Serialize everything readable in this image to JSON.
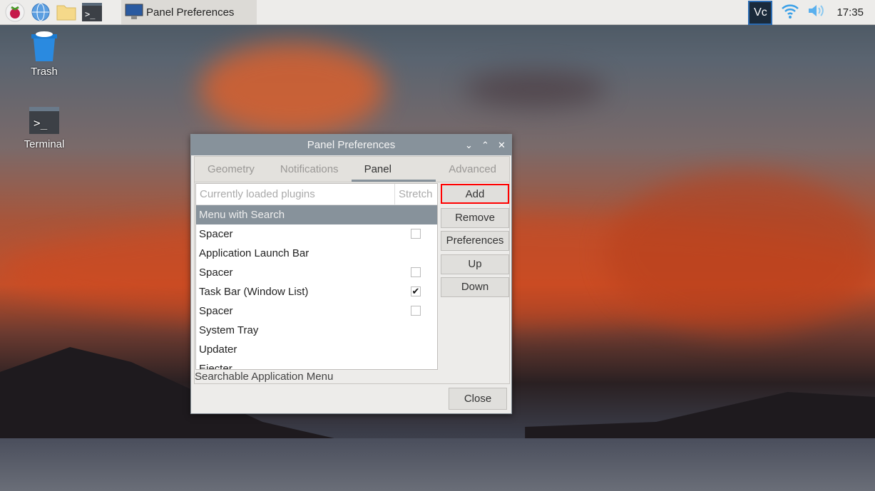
{
  "taskbar": {
    "task_label": "Panel Preferences",
    "clock": "17:35",
    "icons": [
      "raspberry-menu-icon",
      "browser-globe-icon",
      "file-manager-folder-icon",
      "terminal-icon"
    ],
    "tray_icons": [
      "vnc-icon",
      "wifi-icon",
      "volume-icon"
    ]
  },
  "desktop": {
    "icons": [
      {
        "label": "Trash",
        "icon": "trash-icon"
      },
      {
        "label": "Terminal",
        "icon": "terminal-icon"
      }
    ]
  },
  "dialog": {
    "title": "Panel Preferences",
    "tabs": [
      "Geometry",
      "Notifications",
      "Panel Applets",
      "Advanced"
    ],
    "active_tab": "Panel Applets",
    "list": {
      "col_plugins": "Currently loaded plugins",
      "col_stretch": "Stretch",
      "rows": [
        {
          "name": "Menu with Search",
          "stretch": null,
          "selected": true
        },
        {
          "name": "Spacer",
          "stretch": false
        },
        {
          "name": "Application Launch Bar",
          "stretch": null
        },
        {
          "name": "Spacer",
          "stretch": false
        },
        {
          "name": "Task Bar (Window List)",
          "stretch": true
        },
        {
          "name": "Spacer",
          "stretch": false
        },
        {
          "name": "System Tray",
          "stretch": null
        },
        {
          "name": "Updater",
          "stretch": null
        },
        {
          "name": "Ejecter",
          "stretch": null
        }
      ]
    },
    "description": "Searchable Application Menu",
    "buttons": {
      "add": "Add",
      "remove": "Remove",
      "preferences": "Preferences",
      "up": "Up",
      "down": "Down",
      "close": "Close"
    },
    "highlight_color": "#ff0000"
  }
}
